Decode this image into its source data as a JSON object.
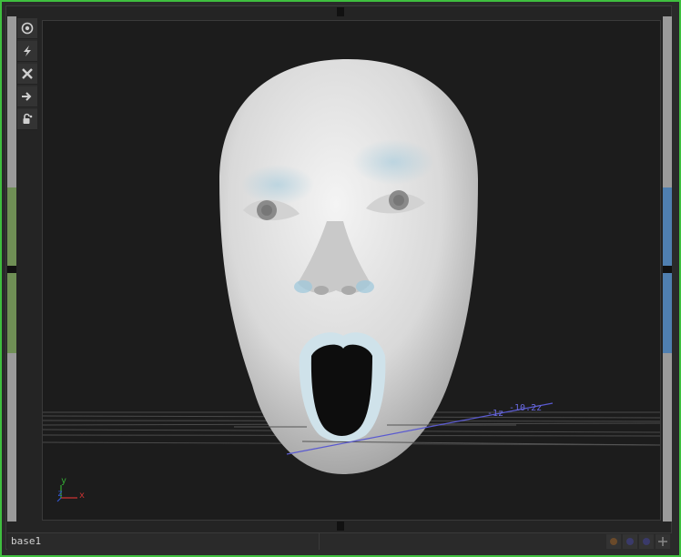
{
  "statusbar": {
    "text": "base1"
  },
  "viewport": {
    "axis": {
      "x": "x",
      "y": "y",
      "z": "z"
    },
    "guide_labels": [
      "-1z",
      "-10.2z"
    ]
  },
  "toolbar": {
    "icons": [
      "target-icon",
      "lightning-icon",
      "close-icon",
      "arrow-right-icon",
      "lock-icon"
    ]
  },
  "colors": {
    "frame_border": "#3fbf3f",
    "left_accent": "#6f8f55",
    "right_accent": "#4f7fb0",
    "guide_line": "#5a5ad0",
    "axis_x": "#cc3333",
    "axis_y": "#33aa33",
    "axis_z": "#3355cc"
  }
}
